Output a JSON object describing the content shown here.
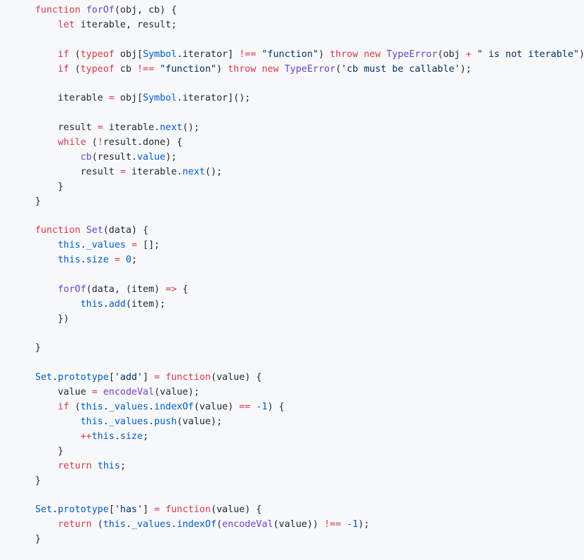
{
  "language": "javascript",
  "colors": {
    "background": "#f6f8fa",
    "text": "#24292e",
    "keyword": "#d73a49",
    "function_name": "#6f42c1",
    "constant": "#005cc5",
    "string": "#032f62"
  },
  "lines": [
    [
      [
        "k",
        "function"
      ],
      [
        "p",
        " "
      ],
      [
        "f",
        "forOf"
      ],
      [
        "p",
        "(obj, cb) {"
      ]
    ],
    [
      [
        "p",
        "    "
      ],
      [
        "k",
        "let"
      ],
      [
        "p",
        " iterable, result;"
      ]
    ],
    [],
    [
      [
        "p",
        "    "
      ],
      [
        "k",
        "if"
      ],
      [
        "p",
        " ("
      ],
      [
        "k",
        "typeof"
      ],
      [
        "p",
        " obj["
      ],
      [
        "c",
        "Symbol"
      ],
      [
        "p",
        ".iterator] "
      ],
      [
        "k",
        "!=="
      ],
      [
        "p",
        " "
      ],
      [
        "s",
        "\"function\""
      ],
      [
        "p",
        ") "
      ],
      [
        "k",
        "throw"
      ],
      [
        "p",
        " "
      ],
      [
        "k",
        "new"
      ],
      [
        "p",
        " "
      ],
      [
        "f",
        "TypeError"
      ],
      [
        "p",
        "(obj "
      ],
      [
        "k",
        "+"
      ],
      [
        "p",
        " "
      ],
      [
        "s",
        "\" is not iterable\""
      ],
      [
        "p",
        ");"
      ]
    ],
    [
      [
        "p",
        "    "
      ],
      [
        "k",
        "if"
      ],
      [
        "p",
        " ("
      ],
      [
        "k",
        "typeof"
      ],
      [
        "p",
        " cb "
      ],
      [
        "k",
        "!=="
      ],
      [
        "p",
        " "
      ],
      [
        "s",
        "\"function\""
      ],
      [
        "p",
        ") "
      ],
      [
        "k",
        "throw"
      ],
      [
        "p",
        " "
      ],
      [
        "k",
        "new"
      ],
      [
        "p",
        " "
      ],
      [
        "f",
        "TypeError"
      ],
      [
        "p",
        "("
      ],
      [
        "s",
        "'cb must be callable'"
      ],
      [
        "p",
        ");"
      ]
    ],
    [],
    [
      [
        "p",
        "    iterable "
      ],
      [
        "k",
        "="
      ],
      [
        "p",
        " obj["
      ],
      [
        "c",
        "Symbol"
      ],
      [
        "p",
        ".iterator]();"
      ]
    ],
    [],
    [
      [
        "p",
        "    result "
      ],
      [
        "k",
        "="
      ],
      [
        "p",
        " iterable."
      ],
      [
        "c",
        "next"
      ],
      [
        "p",
        "();"
      ]
    ],
    [
      [
        "p",
        "    "
      ],
      [
        "k",
        "while"
      ],
      [
        "p",
        " ("
      ],
      [
        "k",
        "!"
      ],
      [
        "p",
        "result.done) {"
      ]
    ],
    [
      [
        "p",
        "        "
      ],
      [
        "f",
        "cb"
      ],
      [
        "p",
        "(result."
      ],
      [
        "c",
        "value"
      ],
      [
        "p",
        ");"
      ]
    ],
    [
      [
        "p",
        "        result "
      ],
      [
        "k",
        "="
      ],
      [
        "p",
        " iterable."
      ],
      [
        "c",
        "next"
      ],
      [
        "p",
        "();"
      ]
    ],
    [
      [
        "p",
        "    }"
      ]
    ],
    [
      [
        "p",
        "}"
      ]
    ],
    [],
    [
      [
        "k",
        "function"
      ],
      [
        "p",
        " "
      ],
      [
        "f",
        "Set"
      ],
      [
        "p",
        "(data) {"
      ]
    ],
    [
      [
        "p",
        "    "
      ],
      [
        "c",
        "this"
      ],
      [
        "p",
        "."
      ],
      [
        "c",
        "_values"
      ],
      [
        "p",
        " "
      ],
      [
        "k",
        "="
      ],
      [
        "p",
        " [];"
      ]
    ],
    [
      [
        "p",
        "    "
      ],
      [
        "c",
        "this"
      ],
      [
        "p",
        "."
      ],
      [
        "c",
        "size"
      ],
      [
        "p",
        " "
      ],
      [
        "k",
        "="
      ],
      [
        "p",
        " "
      ],
      [
        "c",
        "0"
      ],
      [
        "p",
        ";"
      ]
    ],
    [],
    [
      [
        "p",
        "    "
      ],
      [
        "f",
        "forOf"
      ],
      [
        "p",
        "(data, (item) "
      ],
      [
        "k",
        "=>"
      ],
      [
        "p",
        " {"
      ]
    ],
    [
      [
        "p",
        "        "
      ],
      [
        "c",
        "this"
      ],
      [
        "p",
        "."
      ],
      [
        "c",
        "add"
      ],
      [
        "p",
        "(item);"
      ]
    ],
    [
      [
        "p",
        "    })"
      ]
    ],
    [],
    [
      [
        "p",
        "}"
      ]
    ],
    [],
    [
      [
        "c",
        "Set"
      ],
      [
        "p",
        "."
      ],
      [
        "c",
        "prototype"
      ],
      [
        "p",
        "["
      ],
      [
        "s",
        "'add'"
      ],
      [
        "p",
        "] "
      ],
      [
        "k",
        "="
      ],
      [
        "p",
        " "
      ],
      [
        "k",
        "function"
      ],
      [
        "p",
        "(value) {"
      ]
    ],
    [
      [
        "p",
        "    value "
      ],
      [
        "k",
        "="
      ],
      [
        "p",
        " "
      ],
      [
        "f",
        "encodeVal"
      ],
      [
        "p",
        "(value);"
      ]
    ],
    [
      [
        "p",
        "    "
      ],
      [
        "k",
        "if"
      ],
      [
        "p",
        " ("
      ],
      [
        "c",
        "this"
      ],
      [
        "p",
        "."
      ],
      [
        "c",
        "_values"
      ],
      [
        "p",
        "."
      ],
      [
        "c",
        "indexOf"
      ],
      [
        "p",
        "(value) "
      ],
      [
        "k",
        "=="
      ],
      [
        "p",
        " "
      ],
      [
        "c",
        "-1"
      ],
      [
        "p",
        ") {"
      ]
    ],
    [
      [
        "p",
        "        "
      ],
      [
        "c",
        "this"
      ],
      [
        "p",
        "."
      ],
      [
        "c",
        "_values"
      ],
      [
        "p",
        "."
      ],
      [
        "c",
        "push"
      ],
      [
        "p",
        "(value);"
      ]
    ],
    [
      [
        "p",
        "        "
      ],
      [
        "k",
        "++"
      ],
      [
        "c",
        "this"
      ],
      [
        "p",
        "."
      ],
      [
        "c",
        "size"
      ],
      [
        "p",
        ";"
      ]
    ],
    [
      [
        "p",
        "    }"
      ]
    ],
    [
      [
        "p",
        "    "
      ],
      [
        "k",
        "return"
      ],
      [
        "p",
        " "
      ],
      [
        "c",
        "this"
      ],
      [
        "p",
        ";"
      ]
    ],
    [
      [
        "p",
        "}"
      ]
    ],
    [],
    [
      [
        "c",
        "Set"
      ],
      [
        "p",
        "."
      ],
      [
        "c",
        "prototype"
      ],
      [
        "p",
        "["
      ],
      [
        "s",
        "'has'"
      ],
      [
        "p",
        "] "
      ],
      [
        "k",
        "="
      ],
      [
        "p",
        " "
      ],
      [
        "k",
        "function"
      ],
      [
        "p",
        "(value) {"
      ]
    ],
    [
      [
        "p",
        "    "
      ],
      [
        "k",
        "return"
      ],
      [
        "p",
        " ("
      ],
      [
        "c",
        "this"
      ],
      [
        "p",
        "."
      ],
      [
        "c",
        "_values"
      ],
      [
        "p",
        "."
      ],
      [
        "c",
        "indexOf"
      ],
      [
        "p",
        "("
      ],
      [
        "f",
        "encodeVal"
      ],
      [
        "p",
        "(value)) "
      ],
      [
        "k",
        "!=="
      ],
      [
        "p",
        " "
      ],
      [
        "c",
        "-1"
      ],
      [
        "p",
        ");"
      ]
    ],
    [
      [
        "p",
        "}"
      ]
    ]
  ]
}
